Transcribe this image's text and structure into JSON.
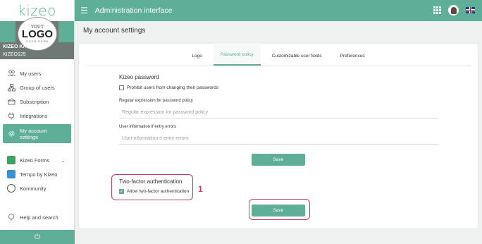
{
  "brand": {
    "name": "kizeo"
  },
  "logo": {
    "your": "YOUT",
    "big": "LOGO",
    "small": "GOES HERE"
  },
  "user": {
    "name": "KIZEO KAVITHA",
    "code": "KIZEO125"
  },
  "sidebar": {
    "items": [
      {
        "label": "My users",
        "icon": "users-icon"
      },
      {
        "label": "Group of users",
        "icon": "group-icon"
      },
      {
        "label": "Subscription",
        "icon": "subscription-icon"
      },
      {
        "label": "Integrations",
        "icon": "plug-icon"
      },
      {
        "label": "My account settings",
        "icon": "gear-icon",
        "active": true
      }
    ],
    "apps": [
      {
        "label": "Kizeo Forms",
        "color": "#3fa45b"
      },
      {
        "label": "Tempo by Kizeo",
        "color": "#3a8fd6"
      },
      {
        "label": "Kommunity",
        "color": "#555555"
      }
    ],
    "help": "Help and search",
    "power": "⏻"
  },
  "header": {
    "title": "Administration interface",
    "menu_icon": "☰"
  },
  "page": {
    "title": "My account settings"
  },
  "tabs": [
    {
      "label": "Logo",
      "active": false
    },
    {
      "label": "Password policy",
      "active": true
    },
    {
      "label": "Customizable user fields",
      "active": false
    },
    {
      "label": "Preferences",
      "active": false
    }
  ],
  "password": {
    "title": "Kizeo password",
    "prohibit_label": "Prohibit users from changing their passwords",
    "regex_label": "Regular expression for password policy",
    "regex_placeholder": "Regular expression for password policy",
    "userinfo_label": "User information if entry errors",
    "userinfo_placeholder": "User information if entry errors",
    "save_label": "Save"
  },
  "twofa": {
    "title": "Two-factor authentication",
    "allow_label": "Allow two-factor authentication",
    "allow_checked": true,
    "save_label": "Save",
    "step_number": "1"
  },
  "colors": {
    "accent": "#5fae98",
    "highlight": "#c43a6b"
  }
}
